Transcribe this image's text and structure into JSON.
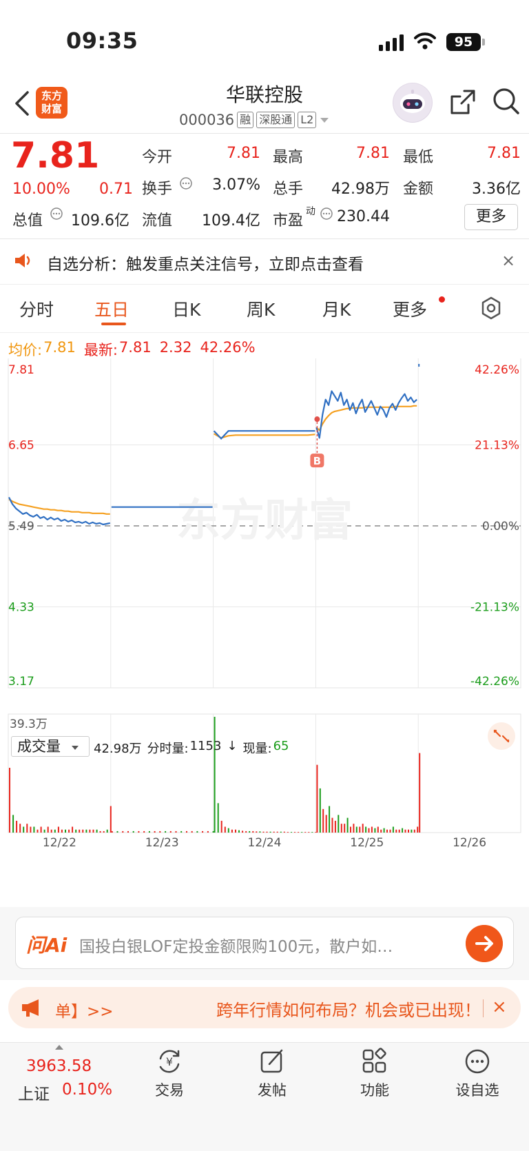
{
  "status": {
    "time": "09:35",
    "battery": "95"
  },
  "header": {
    "logo": [
      "东方",
      "财富"
    ],
    "name": "华联控股",
    "code": "000036",
    "tags": [
      "融",
      "深股通",
      "L2"
    ]
  },
  "quote": {
    "price": "7.81",
    "change_pct": "10.00%",
    "change": "0.71",
    "fields": {
      "open_label": "今开",
      "open": "7.81",
      "high_label": "最高",
      "high": "7.81",
      "low_label": "最低",
      "low": "7.81",
      "turnover_label": "换手",
      "turnover": "3.07%",
      "volume_label": "总手",
      "volume": "42.98万",
      "amount_label": "金额",
      "amount": "3.36亿",
      "mktcap_label": "总值",
      "mktcap": "109.6亿",
      "float_label": "流值",
      "float": "109.4亿",
      "pe_label": "市盈",
      "pe_sup": "动",
      "pe": "230.44"
    },
    "more_label": "更多"
  },
  "signal_banner": {
    "text": "自选分析：触发重点关注信号，立即点击查看",
    "close": "×"
  },
  "tabs": [
    "分时",
    "五日",
    "日K",
    "周K",
    "月K",
    "更多"
  ],
  "active_tab": "五日",
  "chart_info": {
    "avg_label": "均价:",
    "avg_value": "7.81",
    "latest_label": "最新:",
    "latest_value": "7.81",
    "change": "2.32",
    "change_pct": "42.26%"
  },
  "chart_data": {
    "type": "line",
    "x": [
      "12/22",
      "12/23",
      "12/24",
      "12/25",
      "12/26"
    ],
    "y_left_ticks": [
      "7.81",
      "6.65",
      "5.49",
      "4.33",
      "3.17"
    ],
    "y_right_ticks": [
      "42.26%",
      "21.13%",
      "0.00%",
      "-21.13%",
      "-42.26%"
    ],
    "ylim": [
      3.17,
      7.81
    ],
    "prev_close": 5.49,
    "watermark": "东方财富",
    "signal_marker": "B",
    "series": [
      {
        "day": "12/22",
        "price": [
          5.9,
          5.8,
          5.74,
          5.7,
          5.66,
          5.68,
          5.64,
          5.62,
          5.65,
          5.6,
          5.62,
          5.58,
          5.61,
          5.58,
          5.6,
          5.56,
          5.58,
          5.55,
          5.57,
          5.54,
          5.55,
          5.53,
          5.55,
          5.52,
          5.54,
          5.52,
          5.53,
          5.51,
          5.52,
          5.53
        ],
        "avg": [
          5.87,
          5.84,
          5.82,
          5.8,
          5.79,
          5.78,
          5.77,
          5.76,
          5.75,
          5.74,
          5.73,
          5.73,
          5.72,
          5.72,
          5.71,
          5.71,
          5.7,
          5.7,
          5.69,
          5.69,
          5.69,
          5.68,
          5.68,
          5.68,
          5.67,
          5.67,
          5.67,
          5.67,
          5.66,
          5.66
        ]
      },
      {
        "day": "12/23",
        "price": [
          5.76,
          5.76,
          5.76,
          5.76,
          5.76,
          5.76,
          5.76,
          5.76,
          5.76,
          5.76
        ],
        "avg": []
      },
      {
        "day": "12/24",
        "price": [
          6.85,
          6.74,
          6.85,
          6.85,
          6.85,
          6.85,
          6.85,
          6.85,
          6.85,
          6.85,
          6.85,
          6.85,
          6.85,
          6.85,
          6.85
        ],
        "avg": [
          6.81,
          6.75,
          6.78,
          6.79,
          6.79,
          6.79,
          6.79,
          6.79,
          6.79,
          6.79,
          6.79,
          6.79,
          6.79,
          6.79,
          6.8
        ]
      },
      {
        "day": "12/25",
        "price": [
          6.9,
          6.75,
          7.08,
          7.3,
          7.22,
          7.42,
          7.35,
          7.28,
          7.4,
          7.22,
          7.3,
          7.15,
          7.25,
          7.1,
          7.22,
          7.3,
          7.12,
          7.2,
          7.28,
          7.18,
          7.08,
          7.2,
          7.15,
          7.05,
          7.18,
          7.24,
          7.15,
          7.25,
          7.32,
          7.38,
          7.28,
          7.33,
          7.26,
          7.3
        ],
        "avg": [
          6.9,
          6.86,
          6.95,
          7.02,
          7.07,
          7.11,
          7.13,
          7.14,
          7.15,
          7.16,
          7.17,
          7.17,
          7.18,
          7.18,
          7.18,
          7.18,
          7.19,
          7.19,
          7.19,
          7.19,
          7.19,
          7.19,
          7.19,
          7.19,
          7.19,
          7.19,
          7.2,
          7.2,
          7.2,
          7.2,
          7.2,
          7.2,
          7.21,
          7.21
        ]
      },
      {
        "day": "12/26",
        "price": [
          7.81
        ],
        "avg": []
      }
    ]
  },
  "volume": {
    "selector": "成交量",
    "total": "42.98万",
    "minute_label": "分时量:",
    "minute_value": "1153",
    "arrow": "↓",
    "current_label": "现量:",
    "current_value": "65",
    "max_label": "39.3万",
    "max": 39.3,
    "bars": [
      [
        22,
        6,
        4,
        3,
        2,
        3,
        2,
        2,
        1,
        2,
        1,
        2,
        1,
        1,
        2,
        1,
        1,
        1,
        2,
        1,
        1,
        1,
        1,
        1,
        1,
        1,
        0.5,
        0.5,
        1,
        9
      ],
      [
        0.5,
        0.5,
        0.5,
        0.5,
        0.5,
        0.5,
        0.5,
        0.5,
        0.5,
        0.5,
        0.5,
        0.5,
        0.5,
        0.5,
        0.5,
        0.5,
        0.5,
        0.5,
        0.5,
        0.5
      ],
      [
        39.3,
        10,
        4,
        2,
        1.5,
        1,
        1,
        0.8,
        0.6,
        0.5,
        0.5,
        0.5,
        0.4,
        0.4,
        0.3,
        0.3,
        0.3,
        0.3,
        0.3,
        0.3,
        0.3,
        0.2,
        0.2,
        0.2,
        0.2,
        0.2,
        0.2,
        0.2,
        0.2,
        0.2
      ],
      [
        23,
        15,
        8,
        6,
        9,
        5,
        4,
        6,
        3,
        3,
        5,
        2,
        3,
        2,
        2,
        3,
        2,
        1.5,
        2,
        1.5,
        2,
        1,
        1.5,
        1,
        1,
        2,
        1,
        1,
        1.5,
        1,
        1,
        1,
        1,
        2
      ],
      [
        27
      ]
    ],
    "bar_colors": [
      "red",
      "green"
    ]
  },
  "ai": {
    "logo": "问Ai",
    "text": "国投白银LOF定投金额限购100元，散户如…"
  },
  "promo": {
    "left": "单】>>",
    "right": "跨年行情如何布局？机会或已出现！",
    "close": "×"
  },
  "bottom_nav": {
    "index_value": "3963.58",
    "index_name": "上证",
    "index_pct": "0.10%",
    "items": [
      "交易",
      "发帖",
      "功能",
      "设自选"
    ]
  },
  "colors": {
    "up": "#e8231c",
    "down": "#1a9c1a",
    "accent": "#e8561c",
    "price_line": "#2f6fc2",
    "avg_line": "#f5a020"
  }
}
